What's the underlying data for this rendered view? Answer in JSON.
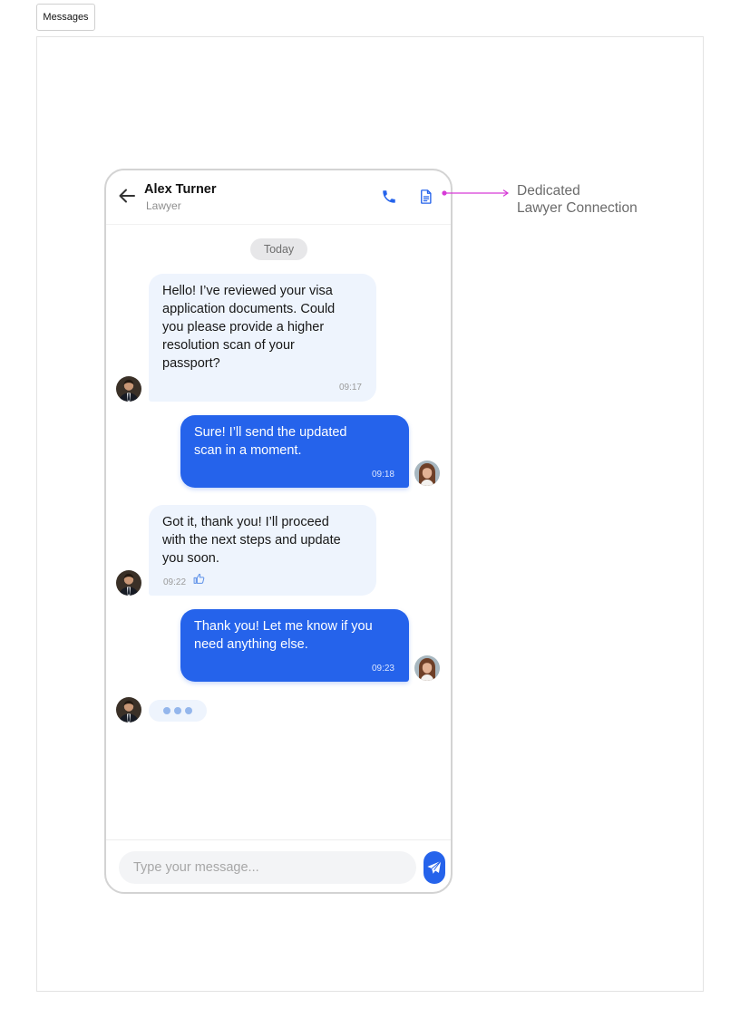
{
  "tag_label": "Messages",
  "header": {
    "contact_name": "Alex Turner",
    "contact_role": "Lawyer",
    "icons": [
      "back-arrow-icon",
      "phone-icon",
      "document-icon"
    ]
  },
  "date_separator": "Today",
  "messages": [
    {
      "direction": "incoming",
      "text": "Hello! I’ve reviewed your visa\napplication documents. Could\nyou please provide a higher\nresolution scan of your\npassport?",
      "time": "09:17"
    },
    {
      "direction": "outgoing",
      "text": "Sure! I’ll send the updated\nscan in a moment.",
      "time": "09:18"
    },
    {
      "direction": "incoming",
      "text": "Got it, thank you! I’ll proceed\nwith the next steps and update\nyou soon.",
      "time": "09:22",
      "reaction_icon": "thumbs-up-icon"
    },
    {
      "direction": "outgoing",
      "text": "Thank you! Let me know if you\nneed anything else.",
      "time": "09:23"
    }
  ],
  "typing_indicator": true,
  "composer": {
    "placeholder": "Type your message...",
    "send_icon": "send-icon"
  },
  "annotation": {
    "text": "Dedicated\nLawyer Connection",
    "color": "#d63ad6"
  },
  "colors": {
    "accent": "#2563eb",
    "incoming_bubble": "#eef4fd",
    "typing_dots": "#94b6ec"
  }
}
